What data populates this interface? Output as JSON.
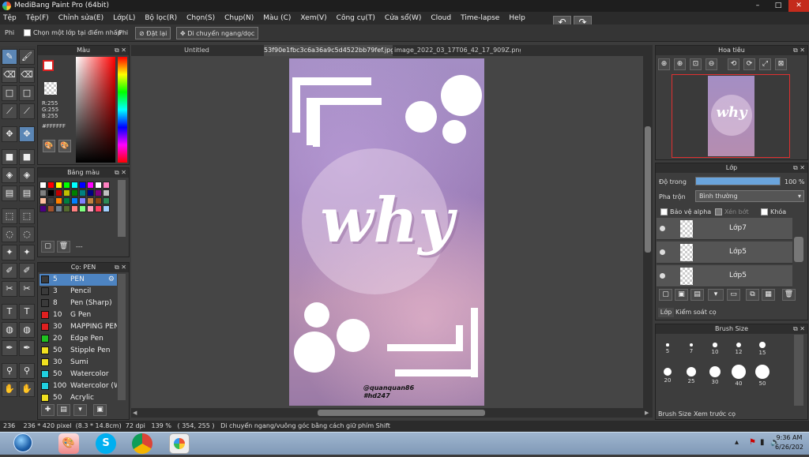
{
  "window": {
    "title": "MediBang Paint Pro (64bit)",
    "min": "–",
    "max": "□",
    "close": "✕"
  },
  "menu": [
    "Tệp",
    "Tệp(F)",
    "Chỉnh sửa(E)",
    "Lớp(L)",
    "Bộ lọc(R)",
    "Chọn(S)",
    "Chụp(N)",
    "Màu (C)",
    "Xem(V)",
    "Công cụ(T)",
    "Cửa sổ(W)",
    "Cloud",
    "Time-lapse",
    "Help"
  ],
  "options": {
    "label1": "Phi",
    "checkbox_label": "Chọn một lớp tại điểm nhấp",
    "label2": "Phi",
    "reset_button": "Đặt lại",
    "move_button": "Di chuyển ngang/dọc"
  },
  "color_panel": {
    "title": "Màu",
    "r": "R:255",
    "g": "G:255",
    "b": "B:255",
    "hex": "#FFFFFF"
  },
  "palette_panel": {
    "title": "Bảng màu",
    "swatches": [
      "#ffffff",
      "#ff0000",
      "#ffff00",
      "#00ff00",
      "#00ffff",
      "#0000ff",
      "#ff00ff",
      "#ffffff",
      "#ff80c0",
      "#808080",
      "#000000",
      "#c00000",
      "#c0c000",
      "#008000",
      "#008080",
      "#000080",
      "#800080",
      "#c0c0c0",
      "#ffc0a0",
      "#404040",
      "#ff8000",
      "#008040",
      "#0080ff",
      "#8080ff",
      "#c08040",
      "#8b4513",
      "#2e8b57",
      "#4b0082",
      "#a0522d",
      "#708090",
      "#556b2f",
      "#ff8080",
      "#80ff80",
      "#ffa0c0",
      "#ff4060",
      "#a0d0ff"
    ],
    "value": "---"
  },
  "brush_panel": {
    "title": "Cọ: PEN",
    "items": [
      {
        "size": "5",
        "name": "PEN",
        "color": "#3a3a3a"
      },
      {
        "size": "3",
        "name": "Pencil",
        "color": "#3a3a3a"
      },
      {
        "size": "8",
        "name": "Pen (Sharp)",
        "color": "#3a3a3a"
      },
      {
        "size": "10",
        "name": "G Pen",
        "color": "#e02020"
      },
      {
        "size": "30",
        "name": "MAPPING PEN",
        "color": "#e02020"
      },
      {
        "size": "20",
        "name": "Edge Pen",
        "color": "#20c020"
      },
      {
        "size": "50",
        "name": "Stipple Pen",
        "color": "#f0e020"
      },
      {
        "size": "30",
        "name": "Sumi",
        "color": "#f0e020"
      },
      {
        "size": "50",
        "name": "Watercolor",
        "color": "#20d0e0"
      },
      {
        "size": "100",
        "name": "Watercolor (W",
        "color": "#20d0e0"
      },
      {
        "size": "50",
        "name": "Acrylic",
        "color": "#f0e020"
      }
    ]
  },
  "tabs": [
    "Untitled",
    "53f90e1fbc3c6a36a9c5d4522bb79fef.jpg",
    "image_2022_03_17T06_42_17_909Z.png"
  ],
  "artwork": {
    "word": "why",
    "credit_line1": "@quanquan86",
    "credit_line2": "#hd247"
  },
  "navigator": {
    "title": "Hoa tiêu",
    "icons": [
      "⊕",
      "⊕",
      "⊡",
      "⊖",
      "⟲",
      "⟳",
      "⤢",
      "⊠"
    ]
  },
  "layer_panel": {
    "title": "Lớp",
    "opacity_label": "Độ trong",
    "opacity_value": "100 %",
    "opacity": 1.0,
    "blend_label": "Pha trộn",
    "blend_value": "Bình thường",
    "protect_alpha": "Bảo vệ alpha",
    "clipping": "Xén bớt",
    "lock": "Khóa",
    "layers": [
      {
        "name": "Lớp7"
      },
      {
        "name": "Lớp5"
      },
      {
        "name": "Lớp5"
      }
    ]
  },
  "layer_tabs": [
    "Lớp",
    "Kiểm soát cọ"
  ],
  "brush_size_panel": {
    "title": "Brush Size",
    "sizes": [
      "5",
      "7",
      "10",
      "12",
      "15",
      "20",
      "25",
      "30",
      "40",
      "50"
    ]
  },
  "brush_size_tabs": [
    "Brush Size",
    "Xem trước cọ"
  ],
  "status": {
    "text": "236    236 * 420 pixel  (8.3 * 14.8cm)  72 dpi   139 %   ( 354, 255 )   Di chuyển ngang/vuông góc bằng cách giữ phím Shift"
  },
  "taskbar": {
    "time": "9:36 AM",
    "date": "6/26/202"
  },
  "colors": {
    "accent": "#4d84c2",
    "nav_border": "#e03030"
  }
}
